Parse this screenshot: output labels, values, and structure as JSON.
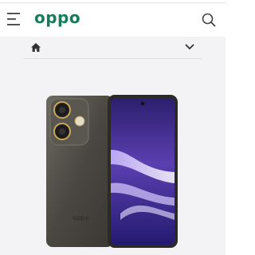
{
  "header": {
    "brand": "oppo",
    "menu_icon": "hamburger-menu-icon",
    "search_icon": "search-icon"
  },
  "breadcrumb": {
    "home_icon": "home-icon",
    "toggle_icon": "chevron-down-icon"
  },
  "product": {
    "image": "phone-product-image",
    "back_logo": "oppo"
  },
  "colors": {
    "brand": "#1a7a5a",
    "body_bg": "#f3f3f5",
    "phone_back": "#4a4741",
    "screen": "#3b2a8c"
  }
}
